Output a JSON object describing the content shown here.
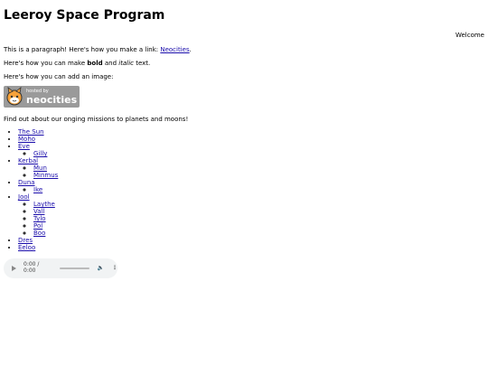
{
  "title": "Leeroy Space Program",
  "welcome": "Welcome",
  "paragraphs": {
    "link_intro": "This is a paragraph! Here's how you make a link: ",
    "link_text": "Neocities",
    "link_end": ".",
    "bold_pre": "Here's how you can make ",
    "bold_word": "bold",
    "bold_mid": " and ",
    "italic_word": "italic",
    "bold_end": " text.",
    "image_intro": "Here's how you can add an image:",
    "missions": "Find out about our onging missions to planets and moons!"
  },
  "badge": {
    "small": "hosted by",
    "big": "neocities",
    "icon": "cat-icon"
  },
  "planets": [
    {
      "name": "The Sun",
      "moons": []
    },
    {
      "name": "Moho",
      "moons": []
    },
    {
      "name": "Eve",
      "moons": [
        "Gilly"
      ]
    },
    {
      "name": "Kerbal",
      "moons": [
        "Mun",
        "Minmus"
      ]
    },
    {
      "name": "Duna",
      "moons": [
        "Ike"
      ]
    },
    {
      "name": "Jool",
      "moons": [
        "Laythe",
        "Vall",
        "Tylo",
        "Pol",
        "Boo"
      ]
    },
    {
      "name": "Dres",
      "moons": []
    },
    {
      "name": "Eeloo",
      "moons": []
    }
  ],
  "audio": {
    "time": "0:00 / 0:00",
    "play_icon": "play-icon",
    "volume_icon": "volume-icon",
    "menu_icon": "more-vert-icon"
  }
}
